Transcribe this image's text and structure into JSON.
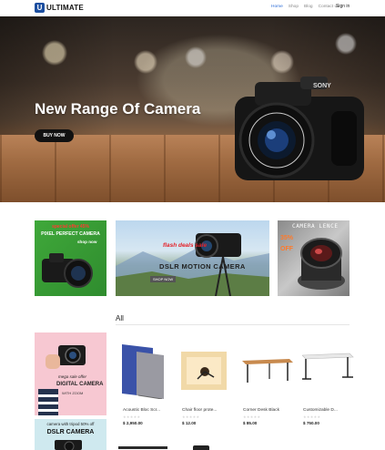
{
  "header": {
    "logo_letter": "U",
    "brand": "ULTIMATE",
    "nav": [
      "Home",
      "Shop",
      "Blog",
      "Contact us"
    ],
    "signin": "Sign in"
  },
  "hero": {
    "title": "New Range Of Camera",
    "button": "BUY NOW",
    "camera_brand": "SONY"
  },
  "promos": {
    "p1": {
      "offer": "special offer 45%",
      "title": "PIXEL PERFECT CAMERA",
      "shop": "shop now"
    },
    "p2": {
      "flash": "flash deals sale",
      "title": "DSLR MOTION CAMERA",
      "shop": "SHOP NOW"
    },
    "p3": {
      "title": "CAMERA LENCE",
      "pct": "35% OFF"
    }
  },
  "category": {
    "label": "All"
  },
  "side_banners": {
    "b1": {
      "offer": "mega sale offer",
      "title": "DIGITAL CAMERA",
      "sub": "WITH ZOOM"
    },
    "b2": {
      "offer": "camera with tripod 50% off",
      "title": "DSLR CAMERA"
    }
  },
  "products": [
    {
      "name": "Acoustic Bloc Scr...",
      "stars": "★★★★★",
      "price": "$ 2,950.00"
    },
    {
      "name": "Chair floor prote...",
      "stars": "★★★★★",
      "price": "$ 12.00"
    },
    {
      "name": "Corner Desk Black",
      "stars": "★★★★★",
      "price": "$ 85.00"
    },
    {
      "name": "Customizable D...",
      "stars": "★★★★★",
      "price": "$ 750.00"
    }
  ],
  "colors": {
    "accent": "#2a6ad6",
    "logo": "#1d4fa0",
    "button": "#111111",
    "flash_red": "#e4222a"
  }
}
